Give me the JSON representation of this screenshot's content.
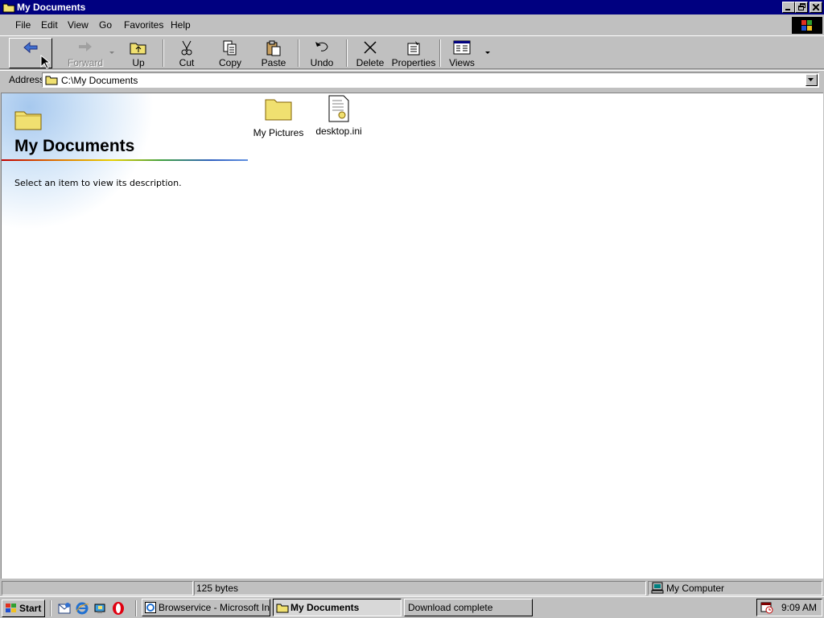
{
  "window": {
    "title": "My Documents"
  },
  "menu": [
    "File",
    "Edit",
    "View",
    "Go",
    "Favorites",
    "Help"
  ],
  "toolbar": {
    "back": "",
    "forward": "Forward",
    "up": "Up",
    "cut": "Cut",
    "copy": "Copy",
    "paste": "Paste",
    "undo": "Undo",
    "delete": "Delete",
    "properties": "Properties",
    "views": "Views"
  },
  "address": {
    "label": "Address",
    "value": "C:\\My Documents"
  },
  "folder_panel": {
    "title": "My Documents",
    "description": "Select an item to view its description."
  },
  "items": [
    {
      "name": "My Pictures",
      "icon": "folder-icon"
    },
    {
      "name": "desktop.ini",
      "icon": "ini-file-icon"
    }
  ],
  "status": {
    "left": "",
    "size": "125 bytes",
    "zone": "My Computer"
  },
  "taskbar": {
    "start": "Start",
    "tasks": [
      "Browservice - Microsoft Int...",
      "My Documents",
      "Download complete"
    ],
    "clock": "9:09 AM"
  },
  "colors": {
    "titlebar": "#000080",
    "face": "#c0c0c0"
  }
}
